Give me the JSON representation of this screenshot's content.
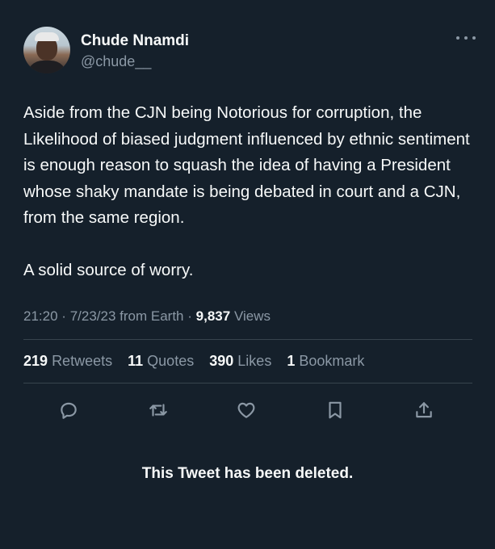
{
  "author": {
    "name": "Chude Nnamdi",
    "handle": "@chude__"
  },
  "tweet": {
    "paragraphs": [
      "Aside from the CJN being Notorious for corruption, the Likelihood of biased judgment influenced by ethnic sentiment is enough reason to squash the idea of having a President whose shaky mandate is being debated in court and a CJN, from the same region.",
      "A solid source of worry."
    ]
  },
  "meta": {
    "time": "21:20",
    "date": "7/23/23",
    "source": "from Earth",
    "separator": "·",
    "views_count": "9,837",
    "views_label": "Views"
  },
  "stats": [
    {
      "count": "219",
      "label": "Retweets"
    },
    {
      "count": "11",
      "label": "Quotes"
    },
    {
      "count": "390",
      "label": "Likes"
    },
    {
      "count": "1",
      "label": "Bookmark"
    }
  ],
  "actions": [
    {
      "name": "reply-icon"
    },
    {
      "name": "retweet-icon"
    },
    {
      "name": "like-icon"
    },
    {
      "name": "bookmark-icon"
    },
    {
      "name": "share-icon"
    }
  ],
  "deleted_notice": "This Tweet has been deleted.",
  "colors": {
    "background": "#15202b",
    "text": "#f7f9f9",
    "muted": "#8b98a5",
    "divider": "#38444d"
  }
}
